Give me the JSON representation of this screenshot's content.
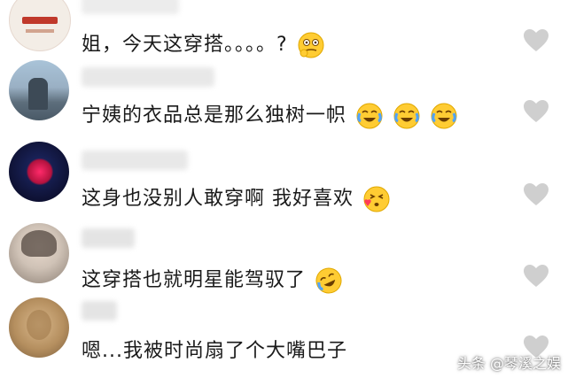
{
  "comments": [
    {
      "username": "",
      "text": "姐，今天这穿搭。。。。?",
      "emoji_icon": "thinking-face-icon"
    },
    {
      "username": "",
      "text": "宁姨的衣品总是那么独树一帜",
      "emoji_icon": "laughing-crying-face-icon"
    },
    {
      "username": "",
      "text": "这身也没别人敢穿啊 我好喜欢",
      "emoji_icon": "kissing-face-icon"
    },
    {
      "username": "",
      "text": "这穿搭也就明星能驾驭了",
      "emoji_icon": "rolling-laughing-face-icon"
    },
    {
      "username": "",
      "text": "嗯...我被时尚扇了个大嘴巴子",
      "emoji_icon": ""
    }
  ],
  "watermark": "头条 @琴溪之娱",
  "colors": {
    "heart": "#cfcfcf",
    "text": "#1a1a1a",
    "background": "#ffffff"
  }
}
